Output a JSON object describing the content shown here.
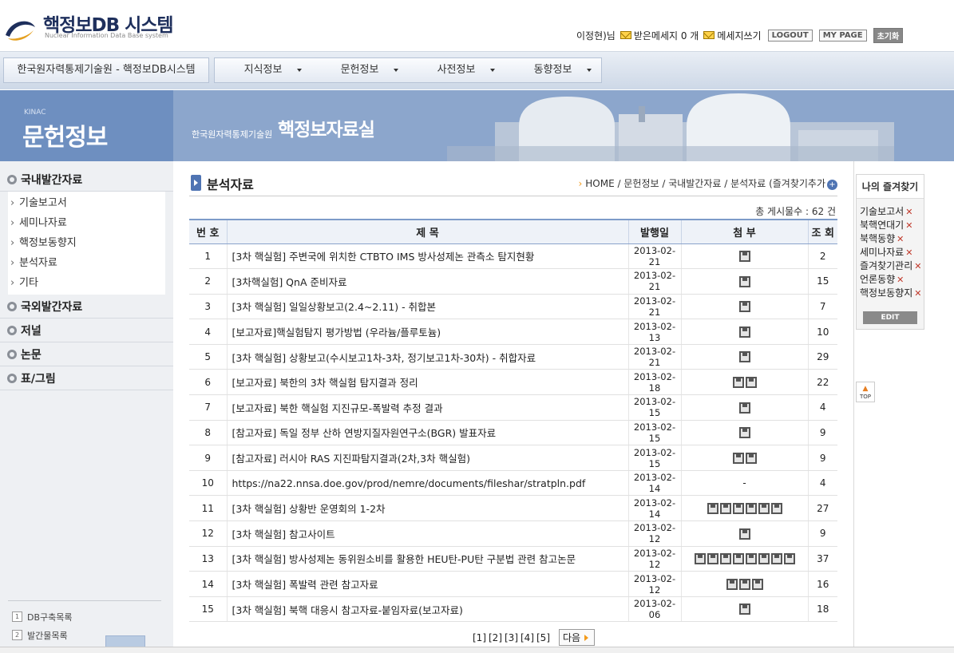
{
  "header": {
    "logo_title": "핵정보DB 시스템",
    "logo_subtitle": "Nuclear Information Data Base system",
    "user_name": "이정현)님",
    "received_msgs": "받은메세지 0 개",
    "write_msg": "메세지쓰기",
    "logout": "LOGOUT",
    "mypage": "MY PAGE",
    "reset": "초기화"
  },
  "nav": {
    "site": "한국원자력통제기술원 - 핵정보DB시스템",
    "menus": [
      "지식정보",
      "문헌정보",
      "사전정보",
      "동향정보"
    ]
  },
  "banner": {
    "kinac": "KINAC",
    "title": "문헌정보",
    "org": "한국원자력통제기술원",
    "room": "핵정보자료실"
  },
  "sidebar": {
    "categories": [
      "국내발간자료",
      "국외발간자료",
      "저널",
      "논문",
      "표/그림"
    ],
    "subitems": [
      "기술보고서",
      "세미나자료",
      "핵정보동향지",
      "분석자료",
      "기타"
    ],
    "bottom_links": [
      {
        "num": "1",
        "label": "DB구축목록"
      },
      {
        "num": "2",
        "label": "발간물목록"
      }
    ]
  },
  "content": {
    "title": "분석자료",
    "breadcrumb": "HOME ∕ 문헌정보 ∕ 국내발간자료 ∕ 분석자료 (즐겨찾기추가",
    "total": "총 게시물수 : 62 건",
    "columns": [
      "번 호",
      "제 목",
      "발행일",
      "첨 부",
      "조 회"
    ],
    "rows": [
      {
        "no": "1",
        "title": "[3차 핵실험] 주변국에 위치한 CTBTO IMS 방사성제논 관측소 탐지현황",
        "date": "2013-02-21",
        "files": 1,
        "views": "2"
      },
      {
        "no": "2",
        "title": "[3차핵실험] QnA 준비자료",
        "date": "2013-02-21",
        "files": 1,
        "views": "15"
      },
      {
        "no": "3",
        "title": "[3차 핵실험] 일일상황보고(2.4~2.11) - 취합본",
        "date": "2013-02-21",
        "files": 1,
        "views": "7"
      },
      {
        "no": "4",
        "title": "[보고자료]핵실험탐지 평가방법 (우라늄/플루토늄)",
        "date": "2013-02-13",
        "files": 1,
        "views": "10"
      },
      {
        "no": "5",
        "title": "[3차 핵실험] 상황보고(수시보고1차-3차, 정기보고1차-30차) - 취합자료",
        "date": "2013-02-21",
        "files": 1,
        "views": "29"
      },
      {
        "no": "6",
        "title": "[보고자료] 북한의 3차 핵실험 탐지결과 정리",
        "date": "2013-02-18",
        "files": 2,
        "views": "22"
      },
      {
        "no": "7",
        "title": "[보고자료] 북한 핵실험 지진규모-폭발력 추정 결과",
        "date": "2013-02-15",
        "files": 1,
        "views": "4"
      },
      {
        "no": "8",
        "title": "[참고자료] 독일 정부 산하 연방지질자원연구소(BGR) 발표자료",
        "date": "2013-02-15",
        "files": 1,
        "views": "9"
      },
      {
        "no": "9",
        "title": "[참고자료] 러시아 RAS 지진파탐지결과(2차,3차 핵실험)",
        "date": "2013-02-15",
        "files": 2,
        "views": "9"
      },
      {
        "no": "10",
        "title": "https://na22.nnsa.doe.gov/prod/nemre/documents/fileshar/stratpln.pdf",
        "date": "2013-02-14",
        "files": 0,
        "views": "4"
      },
      {
        "no": "11",
        "title": "[3차 핵실험] 상황반 운영회의 1-2차",
        "date": "2013-02-14",
        "files": 6,
        "views": "27"
      },
      {
        "no": "12",
        "title": "[3차 핵실험] 참고사이트",
        "date": "2013-02-12",
        "files": 1,
        "views": "9"
      },
      {
        "no": "13",
        "title": "[3차 핵실험] 방사성제논 동위원소비를 활용한 HEU탄-PU탄 구분법 관련 참고논문",
        "date": "2013-02-12",
        "files": 8,
        "views": "37"
      },
      {
        "no": "14",
        "title": "[3차 핵실험] 폭발력 관련 참고자료",
        "date": "2013-02-12",
        "files": 3,
        "views": "16"
      },
      {
        "no": "15",
        "title": "[3차 핵실험] 북핵 대응시 참고자료-붙임자료(보고자료)",
        "date": "2013-02-06",
        "files": 1,
        "views": "18"
      }
    ],
    "no_file_mark": "-",
    "pages": [
      "[1]",
      "[2]",
      "[3]",
      "[4]",
      "[5]"
    ],
    "next": "다음"
  },
  "favorites": {
    "title": "나의 즐겨찾기",
    "items": [
      "기술보고서",
      "북핵연대기",
      "북핵동향",
      "세미나자료",
      "즐겨찾기관리",
      "언론동향",
      "핵정보동향지"
    ],
    "edit": "EDIT",
    "top": "TOP"
  },
  "colors": {
    "accent": "#4f74b3",
    "banner": "#8ca6cc",
    "banner_left": "#6e8fc0",
    "delete": "#c0392b"
  }
}
